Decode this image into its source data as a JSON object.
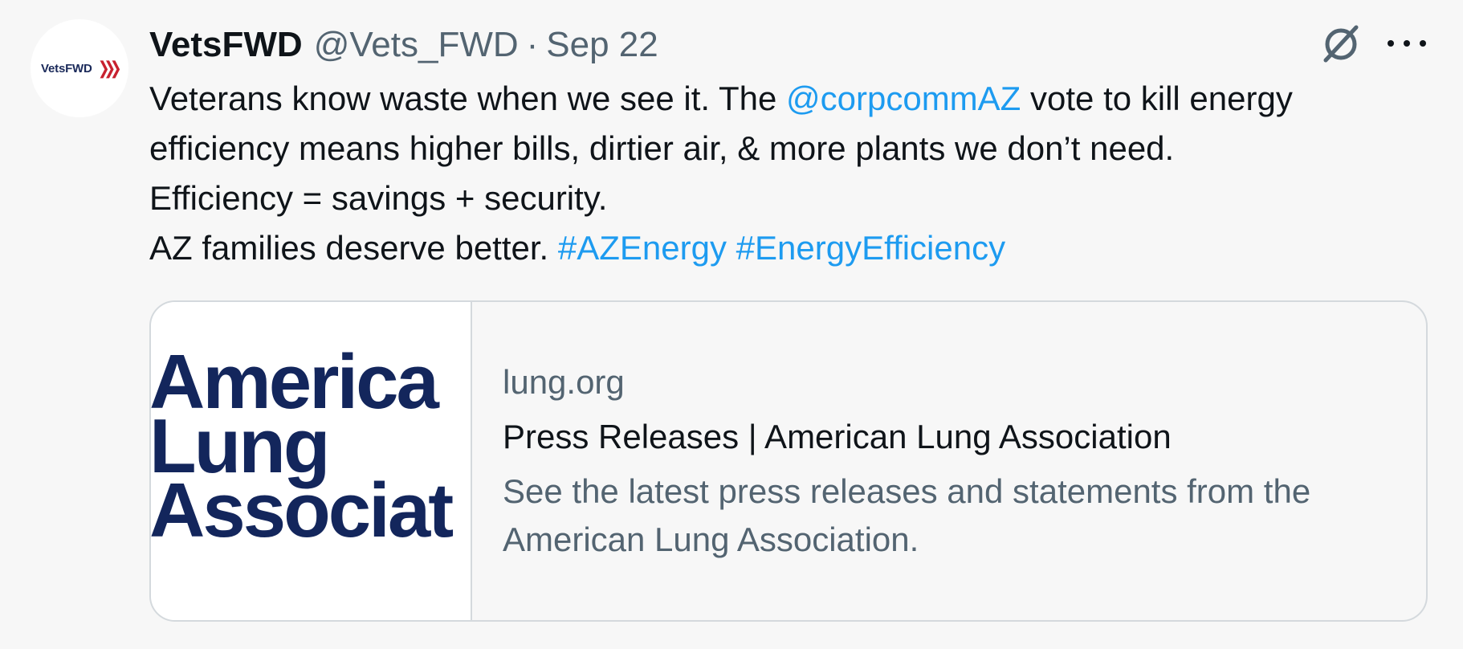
{
  "author": {
    "avatar_text": "VetsFWD",
    "avatar_mark": "❯❯❯",
    "display_name": "VetsFWD",
    "handle": "@Vets_FWD",
    "separator": "·",
    "date": "Sep 22"
  },
  "actions": {
    "grok_icon": "grok-icon",
    "more_icon": "more-icon"
  },
  "tweet": {
    "line1_pre": "Veterans know waste when we see it. The ",
    "line1_mention": "@corpcommAZ",
    "line1_post": " vote to kill energy",
    "line2": "efficiency means higher bills, dirtier air, & more plants we don’t need.",
    "line3": "Efficiency = savings + security.",
    "line4_pre": "AZ families deserve better. ",
    "hashtag1": "#AZEnergy",
    "hashtag2": "#EnergyEfficiency"
  },
  "card": {
    "logo_lines": [
      "America",
      "Lung",
      "Associat"
    ],
    "domain": "lung.org",
    "title": "Press Releases | American Lung Association",
    "description": "See the latest press releases and statements from the American Lung Association."
  },
  "colors": {
    "link": "#1d9bf0",
    "text": "#0f1419",
    "muted": "#536471",
    "background": "#f7f7f7",
    "logo_navy": "#13265c",
    "avatar_red": "#c8212f"
  }
}
